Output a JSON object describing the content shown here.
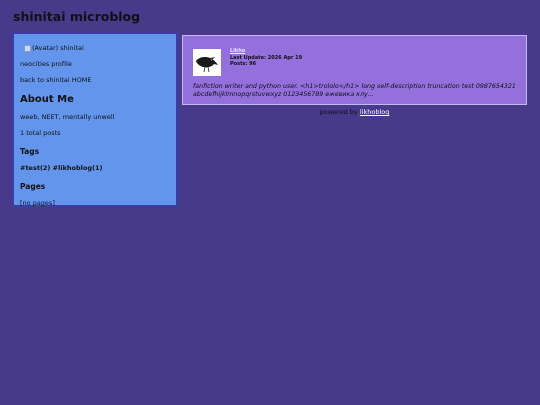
{
  "site": {
    "title": "shinitai microblog"
  },
  "sidebar": {
    "avatar_alt": "(Avatar)",
    "username": "shinitai",
    "links": [
      "neocities profile",
      "back to shinitai HOME"
    ],
    "about_heading": "About Me",
    "about_text": "weeb, NEET, mentally unwell",
    "post_count": "1 total posts",
    "tags_heading": "Tags",
    "tags": [
      "#test(2)",
      "#likhoblog(1)"
    ],
    "pages_heading": "Pages",
    "pages_text": "[no pages]"
  },
  "post": {
    "author": "Likho",
    "last_update": "Last Update: 2026 Apr 19",
    "posts": "Posts: 96",
    "body_line1": "fanfiction writer and python user. <h1>trololo</h1> long self-description truncation test 0987654321",
    "body_line2": "abcdefhijklmnopqrstuvwxyz 0123456789 ежевика клу..."
  },
  "footer": {
    "prefix": "powered by",
    "brand": "likhoblog"
  }
}
